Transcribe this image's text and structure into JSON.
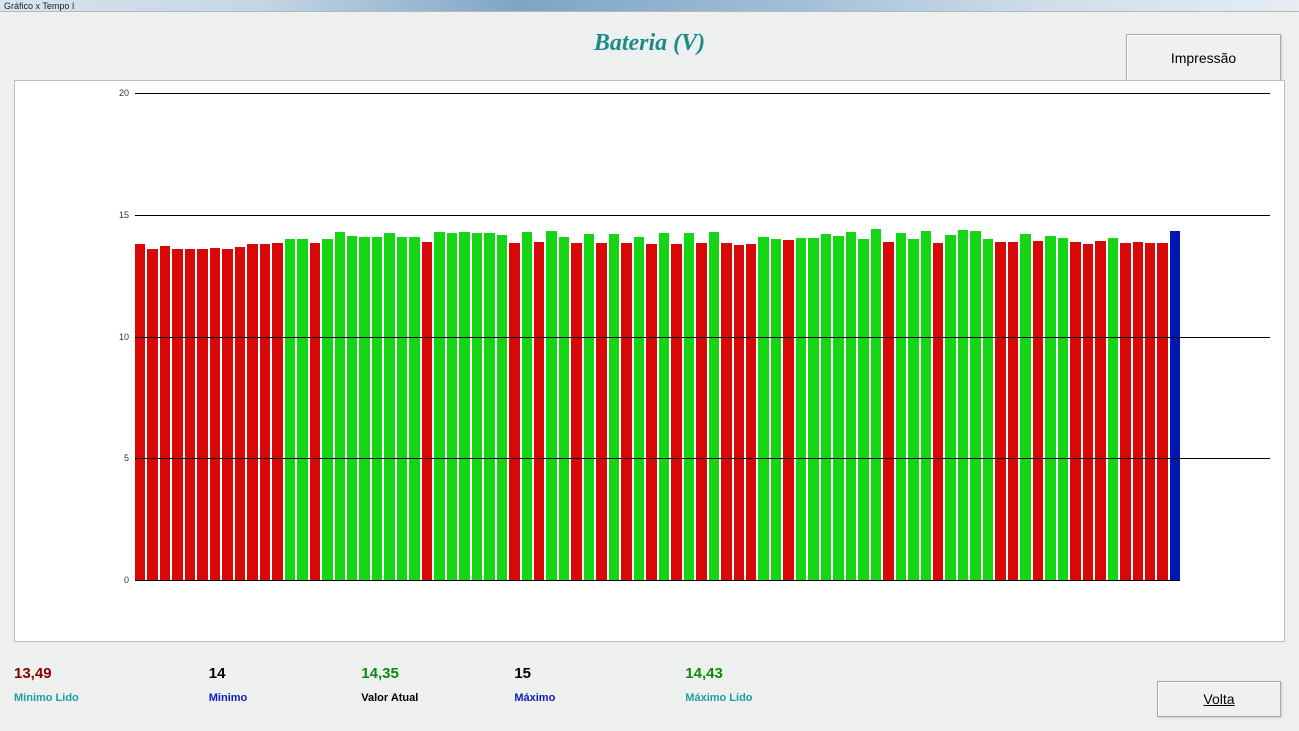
{
  "window_title": "Gráfico x Tempo I",
  "title": "Bateria (V)",
  "buttons": {
    "print": "Impressão",
    "back": "Volta"
  },
  "stats": {
    "min_read": {
      "value": "13,49",
      "label": "Minimo Lido",
      "value_color": "#8b0000",
      "label_color": "#1e9e9e"
    },
    "min": {
      "value": "14",
      "label": "Minimo",
      "value_color": "#000000",
      "label_color": "#1020c0"
    },
    "current": {
      "value": "14,35",
      "label": "Valor Atual",
      "value_color": "#0a8c0a",
      "label_color": "#000000"
    },
    "max": {
      "value": "15",
      "label": "Máximo",
      "value_color": "#000000",
      "label_color": "#1020c0"
    },
    "max_read": {
      "value": "14,43",
      "label": "Máximo Lido",
      "value_color": "#0a8c0a",
      "label_color": "#1e9e9e"
    }
  },
  "stat_positions": {
    "min_read": 0,
    "min": 196,
    "min_col": 196,
    "current": 356,
    "max": 520,
    "max_read": 702
  },
  "chart_data": {
    "type": "bar",
    "title": "Bateria (V)",
    "ylabel": "",
    "xlabel": "",
    "ylim": [
      0,
      20
    ],
    "yticks": [
      0,
      5,
      10,
      15,
      20
    ],
    "colors": {
      "below": "#d80808",
      "inrange": "#14d614",
      "current": "#0018b0"
    },
    "limits": {
      "min": 14,
      "max": 15
    },
    "values": [
      13.8,
      13.58,
      13.7,
      13.58,
      13.6,
      13.6,
      13.64,
      13.6,
      13.66,
      13.78,
      13.78,
      13.84,
      14.0,
      14.0,
      13.86,
      14.02,
      14.3,
      14.12,
      14.1,
      14.1,
      14.24,
      14.1,
      14.1,
      13.9,
      14.3,
      14.26,
      14.3,
      14.26,
      14.24,
      14.18,
      13.86,
      14.28,
      13.88,
      14.34,
      14.1,
      13.86,
      14.2,
      13.82,
      14.2,
      13.82,
      14.1,
      13.8,
      14.26,
      13.8,
      14.26,
      13.82,
      14.3,
      13.82,
      13.76,
      13.78,
      14.1,
      14.02,
      13.96,
      14.06,
      14.06,
      14.22,
      14.14,
      14.28,
      14.02,
      14.4,
      13.88,
      14.26,
      14.0,
      14.34,
      13.86,
      14.18,
      14.38,
      14.32,
      14.0,
      13.88,
      13.9,
      14.22,
      13.92,
      14.14,
      14.06,
      13.9,
      13.8,
      13.94,
      14.04,
      13.84,
      13.88,
      13.86,
      13.84,
      14.35
    ]
  }
}
